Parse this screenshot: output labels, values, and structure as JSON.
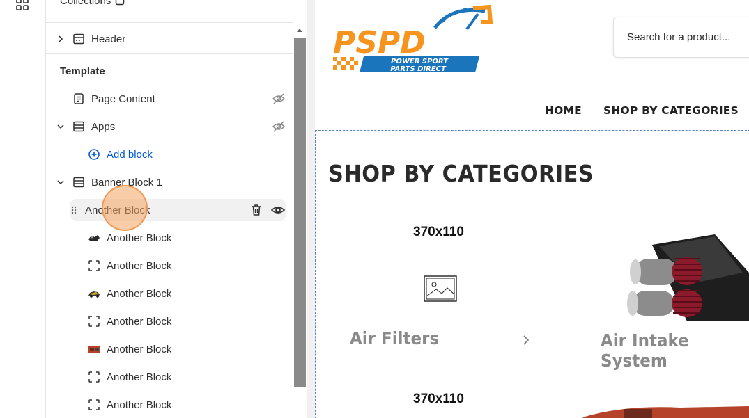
{
  "sidebar": {
    "top_label": "Collections",
    "header_label": "Header",
    "template_title": "Template",
    "page_content_label": "Page Content",
    "apps_label": "Apps",
    "add_block_label": "Add block",
    "banner_label": "Banner Block 1",
    "blocks": [
      {
        "label": "Another Block"
      },
      {
        "label": "Another Block"
      },
      {
        "label": "Another Block"
      },
      {
        "label": "Another Block"
      },
      {
        "label": "Another Block"
      },
      {
        "label": "Another Block"
      },
      {
        "label": "Another Block"
      },
      {
        "label": "Another Block"
      }
    ]
  },
  "preview": {
    "logo_text": "PSPD",
    "logo_sub1": "POWER SPORT",
    "logo_sub2": "PARTS DIRECT",
    "search_placeholder": "Search for a product...",
    "nav": [
      "HOME",
      "SHOP BY CATEGORIES"
    ],
    "section_title": "SHOP BY CATEGORIES",
    "dim_label_1": "370x110",
    "dim_label_2": "370x110",
    "category_1": "Air Filters",
    "category_2": "Air Intake System"
  },
  "colors": {
    "accent_blue": "#005bd3",
    "logo_orange": "#f7941d",
    "logo_blue": "#1b75bc"
  }
}
